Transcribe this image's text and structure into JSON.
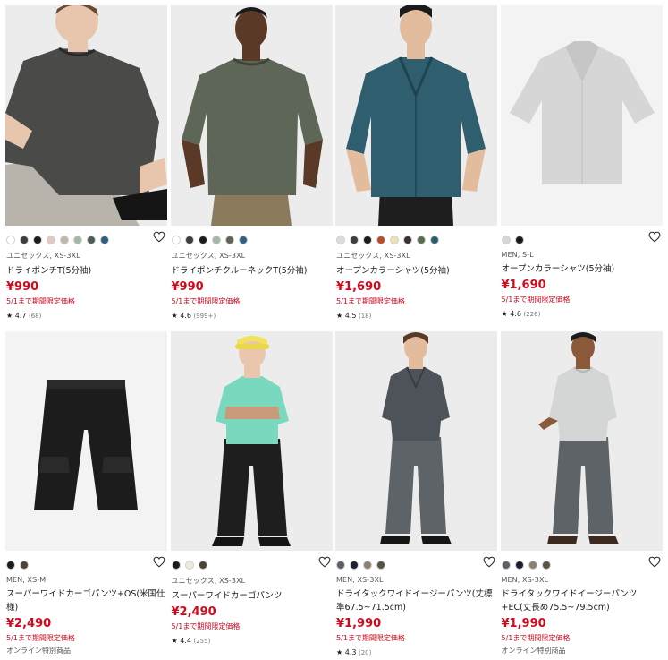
{
  "products": [
    {
      "meta": "ユニセックス, XS-3XL",
      "name": "ドライポンチT(5分袖)",
      "price": "¥990",
      "note": "5/1まで期間限定価格",
      "rating": {
        "score": "4.7",
        "count": "(68)"
      },
      "colors": [
        "#ffffff",
        "#3d3d3d",
        "#1c1c1c",
        "#e3c8c5",
        "#bdb7ad",
        "#a4b7a6",
        "#4c5e52",
        "#2d5f7a"
      ]
    },
    {
      "meta": "ユニセックス, XS-3XL",
      "name": "ドライポンチクルーネックT(5分袖)",
      "price": "¥990",
      "note": "5/1まで期間限定価格",
      "rating": {
        "score": "4.6",
        "count": "(999+)"
      },
      "colors": [
        "#ffffff",
        "#3d3d3d",
        "#1c1c1c",
        "#a4b7a6",
        "#5d6657",
        "#2d6080"
      ]
    },
    {
      "meta": "ユニセックス, XS-3XL",
      "name": "オープンカラーシャツ(5分袖)",
      "price": "¥1,690",
      "note": "5/1まで期間限定価格",
      "rating": {
        "score": "4.5",
        "count": "(18)"
      },
      "colors": [
        "#dcdcdc",
        "#3d3d3d",
        "#1c1c1c",
        "#b84a2e",
        "#ece2b8",
        "#3a3030",
        "#5a6b4f",
        "#2f5e6e"
      ]
    },
    {
      "meta": "MEN, S-L",
      "name": "オープンカラーシャツ(5分袖)",
      "price": "¥1,690",
      "note": "5/1まで期間限定価格",
      "rating": {
        "score": "4.6",
        "count": "(226)"
      },
      "colors": [
        "#d6d6d6",
        "#1c1c1c"
      ]
    },
    {
      "meta": "MEN, XS-M",
      "name": "スーパーワイドカーゴパンツ+OS(米国仕様)",
      "price": "¥2,490",
      "note": "5/1まで期間限定価格",
      "note2": "オンライン特別商品",
      "colors": [
        "#1c1c1c",
        "#4b4336"
      ]
    },
    {
      "meta": "ユニセックス, XS-3XL",
      "name": "スーパーワイドカーゴパンツ",
      "price": "¥2,490",
      "note": "5/1まで期間限定価格",
      "rating": {
        "score": "4.4",
        "count": "(255)"
      },
      "colors": [
        "#1c1c1c",
        "#eeeae0",
        "#4b4336"
      ]
    },
    {
      "meta": "MEN, XS-3XL",
      "name": "ドライタックワイドイージーパンツ(丈標準67.5~71.5cm)",
      "price": "¥1,990",
      "note": "5/1まで期間限定価格",
      "rating": {
        "score": "4.3",
        "count": "(20)"
      },
      "colors": [
        "#5a6066",
        "#1d2230",
        "#8a8172",
        "#5a5344"
      ]
    },
    {
      "meta": "MEN, XS-3XL",
      "name": "ドライタックワイドイージーパンツ+EC(丈長め75.5~79.5cm)",
      "price": "¥1,990",
      "note": "5/1まで期間限定価格",
      "note2": "オンライン特別商品",
      "colors": [
        "#5a6066",
        "#1d2230",
        "#8a8172",
        "#5a5344"
      ]
    }
  ],
  "icons": {
    "wishlist": "heart-outline-icon",
    "star": "star-icon"
  },
  "accent": "#d1091d"
}
